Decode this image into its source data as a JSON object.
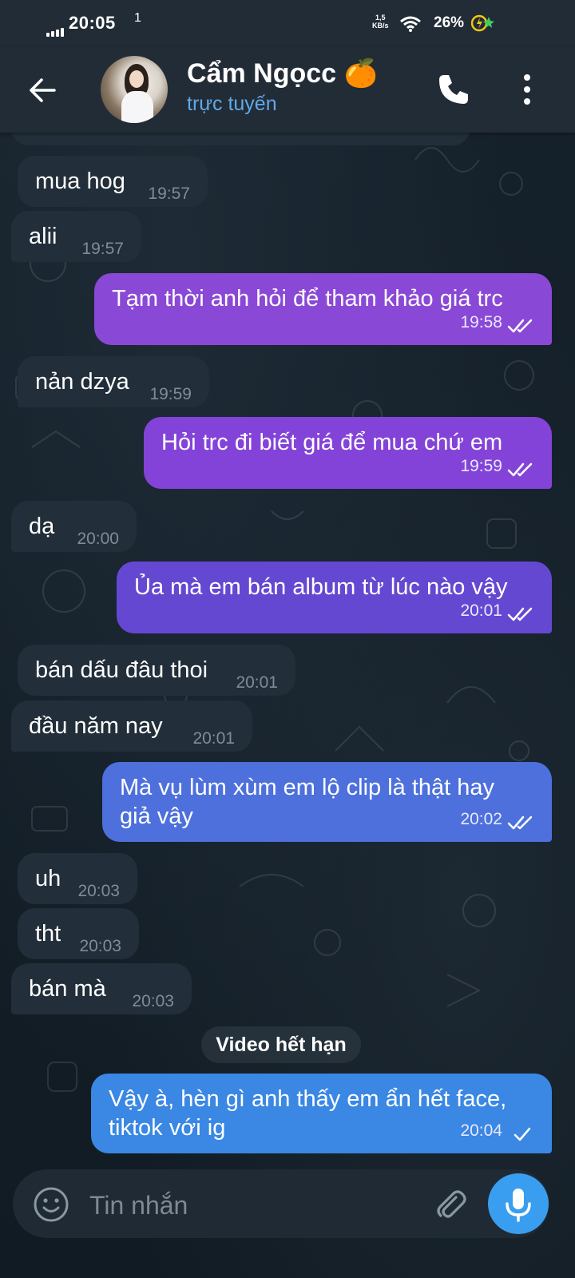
{
  "status_bar": {
    "time": "20:05",
    "extra": "1",
    "speed_value": "1,5",
    "speed_unit": "KB/s",
    "battery": "26%"
  },
  "header": {
    "contact_name": "Cẩm Ngọcc 🍊",
    "status": "trực tuyến"
  },
  "messages": [
    {
      "dir": "in",
      "text": "mua hog",
      "time": "19:57"
    },
    {
      "dir": "in",
      "text": "alii",
      "time": "19:57"
    },
    {
      "dir": "out",
      "text": "Tạm thời anh hỏi để tham khảo giá trc",
      "time": "19:58",
      "read": true
    },
    {
      "dir": "in",
      "text": "nản dzya",
      "time": "19:59"
    },
    {
      "dir": "out",
      "text": "Hỏi trc đi biết giá để mua chứ em",
      "time": "19:59",
      "read": true
    },
    {
      "dir": "in",
      "text": "dạ",
      "time": "20:00"
    },
    {
      "dir": "out",
      "text": "Ủa mà em bán album từ lúc nào vậy",
      "time": "20:01",
      "read": true
    },
    {
      "dir": "in",
      "text": "bán dấu đâu thoi",
      "time": "20:01"
    },
    {
      "dir": "in",
      "text": "đầu năm nay",
      "time": "20:01"
    },
    {
      "dir": "out",
      "text_lines": [
        "Mà vụ lùm xùm em lộ clip là thật hay",
        "giả vậy"
      ],
      "time": "20:02",
      "read": true
    },
    {
      "dir": "in",
      "text": "uh",
      "time": "20:03"
    },
    {
      "dir": "in",
      "text": "tht",
      "time": "20:03"
    },
    {
      "dir": "in",
      "text": "bán mà",
      "time": "20:03"
    },
    {
      "dir": "out",
      "text_lines": [
        "Vậy à, hèn gì anh thấy em ẩn hết face,",
        "tiktok với ig"
      ],
      "time": "20:04",
      "read": false
    }
  ],
  "service_message": "Video hết hạn",
  "composer": {
    "placeholder": "Tin nhắn"
  },
  "colors": {
    "header_bg": "#222c36",
    "incoming_bubble": "#222e39",
    "outgoing_purple": "#8a48d6",
    "outgoing_blue": "#3e7fe0",
    "accent": "#3a9ef0",
    "status_online": "#61a9e8"
  },
  "icons": [
    "back-arrow-icon",
    "phone-icon",
    "more-vertical-icon",
    "emoji-icon",
    "paperclip-icon",
    "microphone-icon",
    "double-check-icon",
    "single-check-icon",
    "wifi-icon",
    "charging-icon"
  ]
}
